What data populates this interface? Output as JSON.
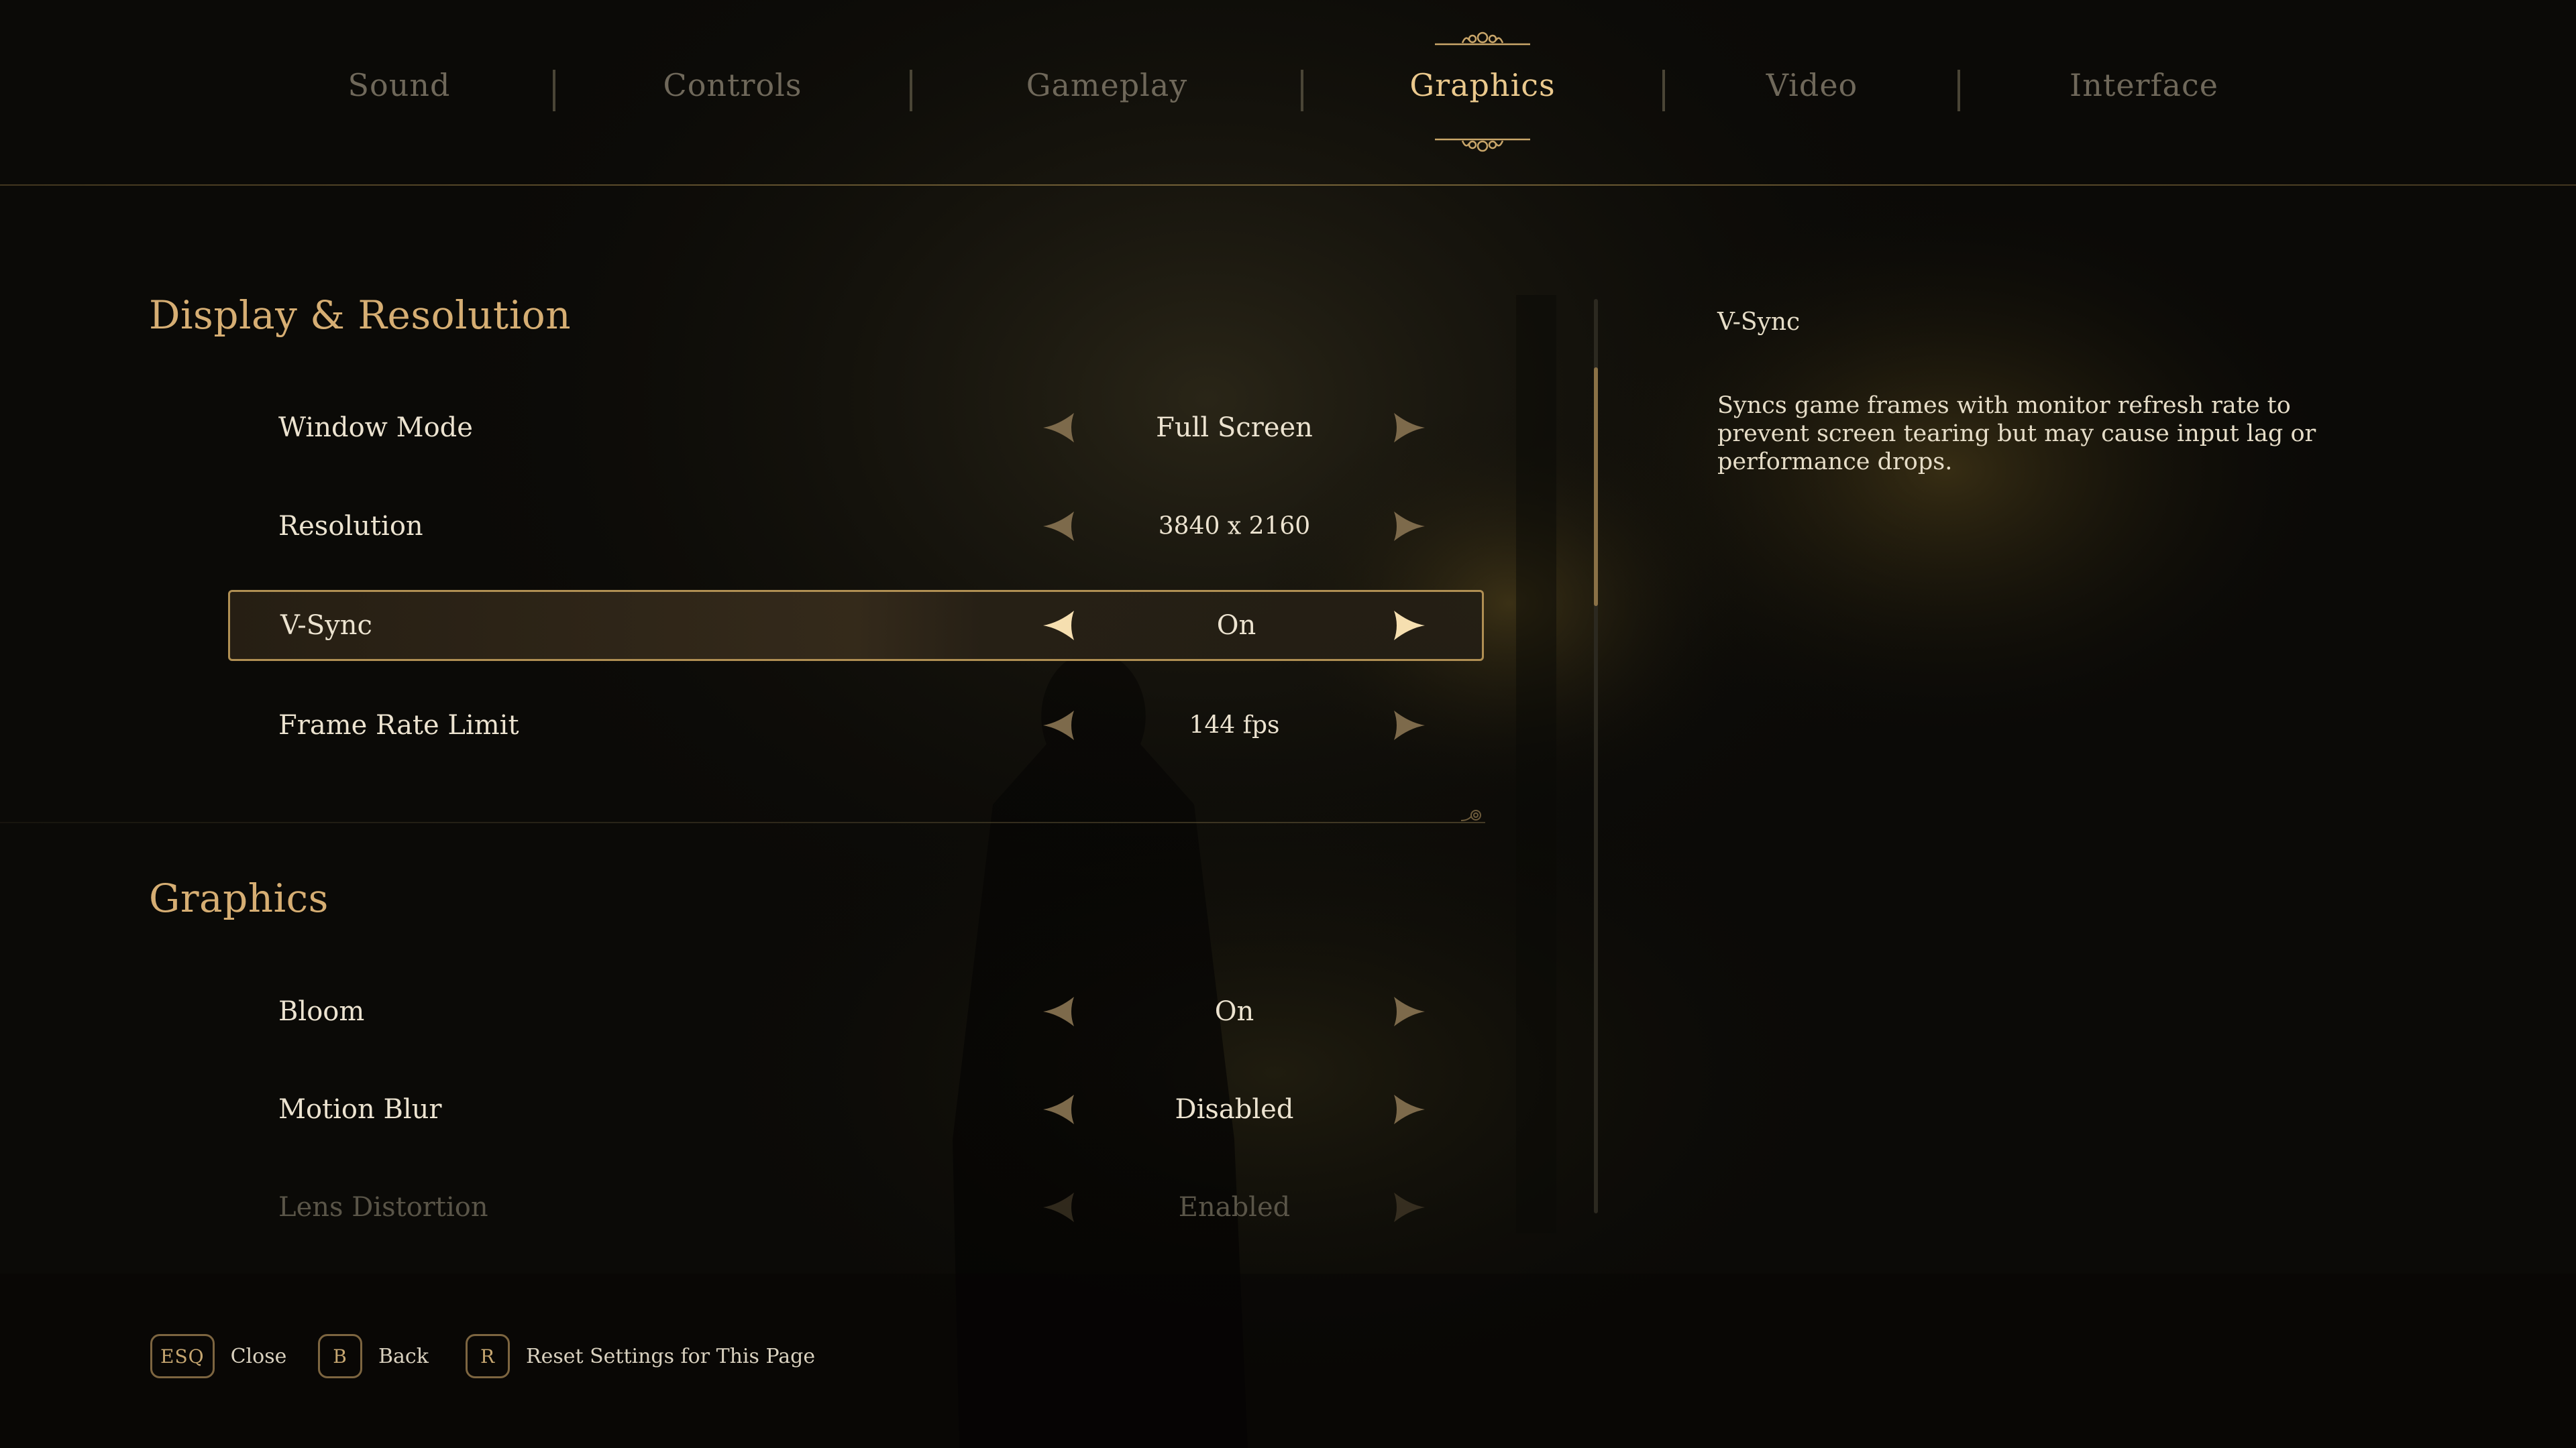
{
  "tabs": {
    "sound": "Sound",
    "controls": "Controls",
    "gameplay": "Gameplay",
    "graphics": "Graphics",
    "video": "Video",
    "interface": "Interface",
    "active": "graphics"
  },
  "sections": {
    "display": {
      "title": "Display & Resolution",
      "rows": [
        {
          "label": "Window Mode",
          "value": "Full Screen"
        },
        {
          "label": "Resolution",
          "value": "3840 x 2160"
        },
        {
          "label": "V-Sync",
          "value": "On",
          "selected": true
        },
        {
          "label": "Frame Rate Limit",
          "value": "144 fps"
        }
      ]
    },
    "graphics": {
      "title": "Graphics",
      "rows": [
        {
          "label": "Bloom",
          "value": "On"
        },
        {
          "label": "Motion Blur",
          "value": "Disabled"
        },
        {
          "label": "Lens Distortion",
          "value": "Enabled"
        }
      ]
    }
  },
  "description": {
    "title": "V-Sync",
    "body": "Syncs game frames with monitor refresh rate to prevent screen tearing but may cause input lag or performance drops."
  },
  "footer": {
    "close": {
      "key": "ESQ",
      "label": "Close"
    },
    "back": {
      "key": "B",
      "label": "Back"
    },
    "reset": {
      "key": "R",
      "label": "Reset Settings for This Page"
    }
  },
  "scrollbar": {
    "position_fraction": 0.08,
    "visible_fraction": 0.26
  },
  "colors": {
    "accent": "#ebc98d",
    "section_title": "#d6ae73",
    "text": "#ece3d0",
    "inactive_tab": "#6f685a",
    "selection_border": "#b08f53",
    "background": "#0b0a07"
  },
  "icons": {
    "tab_ornament": "flourish-ornament-icon",
    "arrow_left": "diamond-arrow-left-icon",
    "arrow_right": "diamond-arrow-right-icon",
    "section_end": "swirl-ornament-icon"
  }
}
